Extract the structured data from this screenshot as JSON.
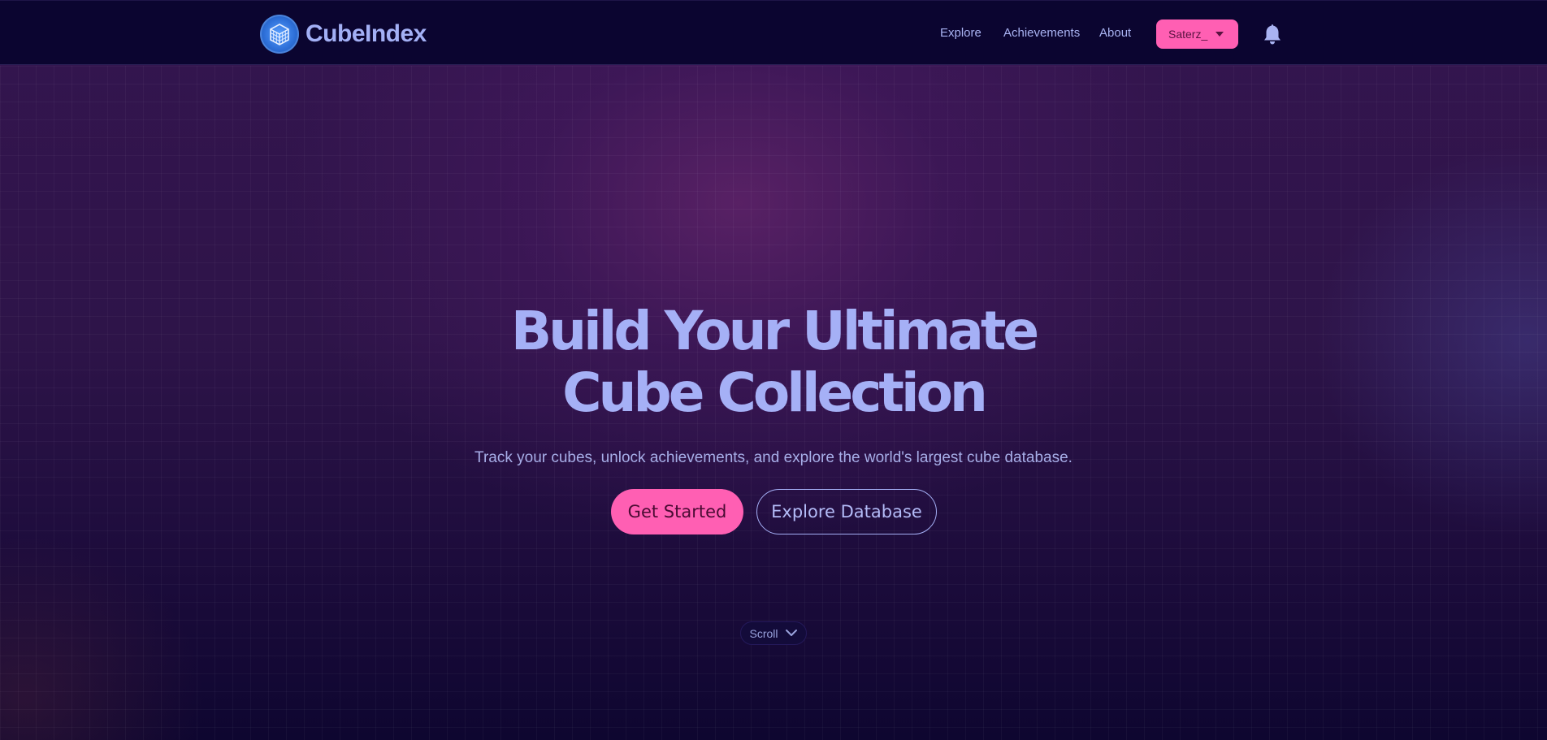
{
  "brand": {
    "name": "CubeIndex",
    "logo_icon": "cube-globe-icon",
    "logo_color": "#2d6fd8"
  },
  "nav": {
    "links": [
      {
        "label": "Explore"
      },
      {
        "label": "Achievements"
      },
      {
        "label": "About"
      }
    ],
    "user": {
      "name": "Saterz_",
      "dropdown_icon": "caret-down-icon"
    },
    "notifications_icon": "bell-icon"
  },
  "hero": {
    "title_line1": "Build Your Ultimate",
    "title_line2": "Cube Collection",
    "subtitle": "Track your cubes, unlock achievements, and explore the world's largest cube database.",
    "primary_cta": "Get Started",
    "secondary_cta": "Explore Database",
    "scroll_label": "Scroll",
    "scroll_icon": "chevron-down-icon"
  },
  "colors": {
    "accent_pink": "#ff5fb3",
    "text_lavender": "#a5b0f6",
    "nav_background": "#0b0530",
    "hero_purple": "#34154f"
  }
}
